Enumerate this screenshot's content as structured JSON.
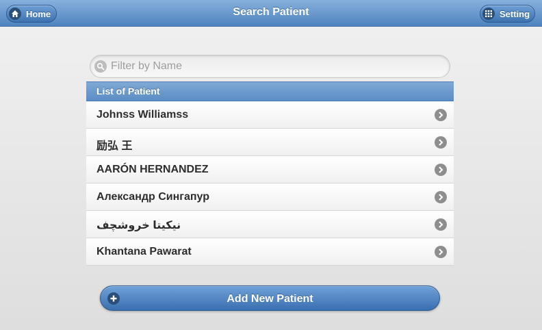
{
  "header": {
    "title": "Search Patient",
    "home_label": "Home",
    "setting_label": "Setting"
  },
  "search": {
    "placeholder": "Filter by Name",
    "value": ""
  },
  "list": {
    "header": "List of Patient",
    "items": [
      {
        "label": "Johnss Williamss"
      },
      {
        "label": "励弘 王"
      },
      {
        "label": "AARÓN HERNANDEZ"
      },
      {
        "label": "Александр Сингапур"
      },
      {
        "label": "نیکیتا خروشچف"
      },
      {
        "label": "Khantana Pawarat"
      }
    ]
  },
  "actions": {
    "add_patient_label": "Add New Patient"
  },
  "icons": {
    "home": "home-icon",
    "setting": "grid-icon",
    "search": "search-icon",
    "arrow": "chevron-right-icon",
    "add": "plus-icon"
  },
  "colors": {
    "header": "#5b8cc4",
    "accent": "#3a6fb0",
    "text": "#2d2d2d"
  }
}
